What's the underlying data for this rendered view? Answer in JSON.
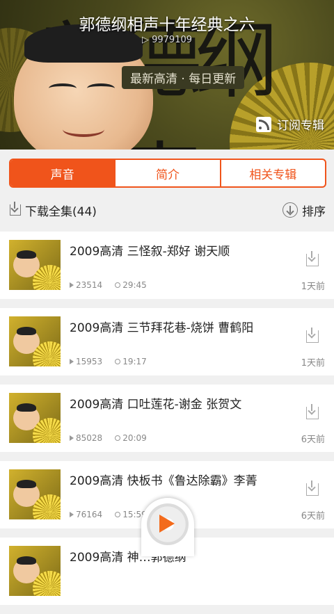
{
  "album": {
    "title": "郭德纲相声十年经典之六",
    "play_count": "9979109",
    "slogan": "最新高清 · 每日更新",
    "subscribe_label": "订阅专辑"
  },
  "tabs": [
    {
      "label": "声音",
      "active": true
    },
    {
      "label": "简介",
      "active": false
    },
    {
      "label": "相关专辑",
      "active": false
    }
  ],
  "toolbar": {
    "download_all_label": "下载全集(44)",
    "sort_label": "排序"
  },
  "tracks": [
    {
      "title": "2009高清 三怪叙-郑好 谢天顺",
      "plays": "23514",
      "duration": "29:45",
      "age": "1天前"
    },
    {
      "title": "2009高清 三节拜花巷-烧饼 曹鹤阳",
      "plays": "15953",
      "duration": "19:17",
      "age": "1天前"
    },
    {
      "title": "2009高清 口吐莲花-谢金 张贺文",
      "plays": "85028",
      "duration": "20:09",
      "age": "6天前"
    },
    {
      "title": "2009高清 快板书《鲁达除霸》李菁",
      "plays": "76164",
      "duration": "15:59",
      "age": "6天前"
    },
    {
      "title": "2009高清 神…郭德纲",
      "plays": "",
      "duration": "",
      "age": ""
    }
  ],
  "colors": {
    "accent": "#f0541b",
    "player_play": "#f36b1c"
  },
  "icons": {
    "subscribe": "rss-icon",
    "download": "download-icon",
    "sort": "sort-icon",
    "player": "play-icon"
  }
}
